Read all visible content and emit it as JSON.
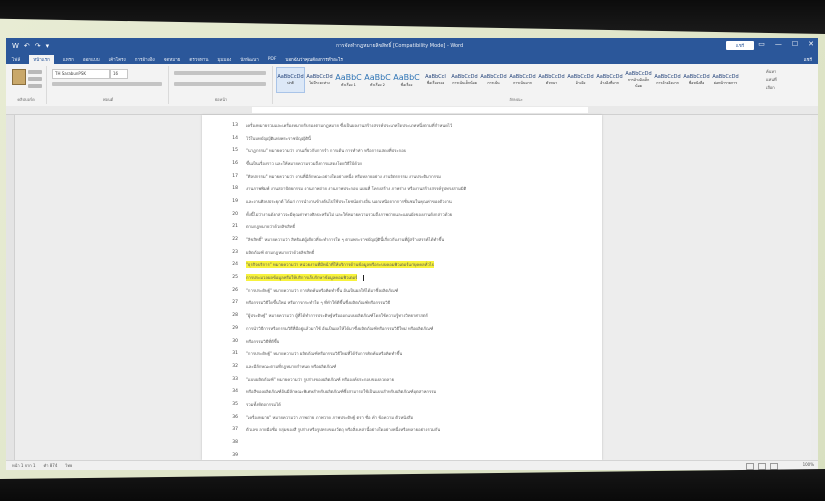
{
  "window": {
    "title": "การจัดทำกฎหมายลิขสิทธิ์ [Compatibility Mode] - Word",
    "signin": "แชร์",
    "controls": [
      "▭",
      "—",
      "☐",
      "✕"
    ]
  },
  "quick_access": [
    "W",
    "↶",
    "↷",
    "▾"
  ],
  "tabs": [
    "ไฟล์",
    "หน้าแรก",
    "แทรก",
    "ออกแบบ",
    "เค้าโครง",
    "การอ้างอิง",
    "จดหมาย",
    "ตรวจทาน",
    "มุมมอง",
    "นักพัฒนา",
    "PDF"
  ],
  "active_tab_index": 1,
  "tell_me": "บอกฉันว่าคุณต้องการทำอะไร",
  "share": "แชร์",
  "ribbon": {
    "clipboard_label": "คลิปบอร์ด",
    "font_name": "TH SarabunPSK",
    "font_size": "16",
    "font_label": "ฟอนต์",
    "paragraph_label": "ย่อหน้า",
    "styles_label": "ลักษณะ",
    "editing_label": "การแก้ไข",
    "editing_items": [
      "ค้นหา",
      "แทนที่",
      "เลือก"
    ],
    "styles": [
      {
        "sample": "AaBbCcDd",
        "name": "ปกติ",
        "big": false,
        "selected": true
      },
      {
        "sample": "AaBbCcDd",
        "name": "ไม่มีระยะห่าง",
        "big": false,
        "selected": false
      },
      {
        "sample": "AaBbC",
        "name": "หัวเรื่อง 1",
        "big": true,
        "selected": false
      },
      {
        "sample": "AaBbC",
        "name": "หัวเรื่อง 2",
        "big": true,
        "selected": false
      },
      {
        "sample": "AaBbC",
        "name": "ชื่อเรื่อง",
        "big": true,
        "selected": false
      },
      {
        "sample": "AaBbCcI",
        "name": "ชื่อเรื่องรอง",
        "big": false,
        "selected": false
      },
      {
        "sample": "AaBbCcDd",
        "name": "การเน้นเล็กน้อย",
        "big": false,
        "selected": false
      },
      {
        "sample": "AaBbCcDd",
        "name": "การเน้น",
        "big": false,
        "selected": false
      },
      {
        "sample": "AaBbCcDd",
        "name": "การเน้นมาก",
        "big": false,
        "selected": false
      },
      {
        "sample": "AaBbCcDd",
        "name": "ตัวหนา",
        "big": false,
        "selected": false
      },
      {
        "sample": "AaBbCcDd",
        "name": "อ้างอิง",
        "big": false,
        "selected": false
      },
      {
        "sample": "AaBbCcDd",
        "name": "อ้างอิงที่มาก",
        "big": false,
        "selected": false
      },
      {
        "sample": "AaBbCcDd",
        "name": "การอ้างอิงเล็กน้อย",
        "big": false,
        "selected": false
      },
      {
        "sample": "AaBbCcDd",
        "name": "การอ้างอิงมาก",
        "big": false,
        "selected": false
      },
      {
        "sample": "AaBbCcDd",
        "name": "ชื่อหนังสือ",
        "big": false,
        "selected": false
      },
      {
        "sample": "AaBbCcDd",
        "name": "ย่อหน้ารายการ",
        "big": false,
        "selected": false
      }
    ]
  },
  "document": {
    "lines": [
      {
        "num": "13",
        "text": "เครื่องหมายรวมและเครื่องหมายรับรองตามกฎหมาย ซึ่งเป็นผลงานสร้างสรรค์ประเภทใดประเภทหนึ่งตามที่กำหนดไว้",
        "highlight": false
      },
      {
        "num": "14",
        "text": "ไว้ในบทบัญญัติแห่งพระราชบัญญัตินี้",
        "highlight": false
      },
      {
        "num": "15",
        "text": "\"นาฏกรรม\" หมายความว่า งานเกี่ยวกับการรำ การเต้น การทำท่า หรือการแสดงที่ประกอบ",
        "highlight": false
      },
      {
        "num": "16",
        "text": "ขึ้นเป็นเรื่องราว และให้หมายความรวมถึงการแสดงโดยวิธีใบ้ด้วย",
        "highlight": false
      },
      {
        "num": "17",
        "text": "\"ศิลปกรรม\" หมายความว่า งานที่มีลักษณะอย่างใดอย่างหนึ่ง หรือหลายอย่าง งานจิตรกรรม งานประติมากรรม",
        "highlight": false
      },
      {
        "num": "18",
        "text": "งานภาพพิมพ์ งานสถาปัตยกรรม งานภาพถ่าย งานภาพประกอบ แผนที่ โครงสร้าง ภาพร่าง หรืองานสร้างสรรค์รูปทรงสามมิติ",
        "highlight": false
      },
      {
        "num": "19",
        "text": "และงานศิลปประยุกต์ ได้แก่ การนำงานข้างต้นไปใช้ประโยชน์อย่างอื่น นอกเหนือจากการชื่นชมในคุณค่าของตัวงาน",
        "highlight": false
      },
      {
        "num": "20",
        "text": "ทั้งนี้ไม่ว่างานดังกล่าวจะมีคุณค่าทางศิลปะหรือไม่ และให้หมายความรวมถึงภาพถ่ายและแผนผังของงานดังกล่าวด้วย",
        "highlight": false
      },
      {
        "num": "21",
        "text": "ตามกฎหมายว่าด้วยลิขสิทธิ์",
        "highlight": false
      },
      {
        "num": "22",
        "text": "\"ลิขสิทธิ์\" หมายความว่า สิทธิแต่ผู้เดียวที่จะทำการใด ๆ ตามพระราชบัญญัตินี้เกี่ยวกับงานที่ผู้สร้างสรรค์ได้ทำขึ้น",
        "highlight": false
      },
      {
        "num": "23",
        "text": "ผลิตภัณฑ์ ตามกฎหมายว่าด้วยลิขสิทธิ์",
        "highlight": false
      },
      {
        "num": "24",
        "text": "\"ธุรกิจบริการ\" หมายความว่า หน่วยงานที่มีหน้าที่ให้บริการด้านข้อมูลหรือระบบคอมพิวเตอร์แก่บุคคลทั่วไป",
        "highlight": true
      },
      {
        "num": "25",
        "text": "การประมวลผลข้อมูลหรือให้บริการเก็บรักษาข้อมูลคอมพิวเตอร์",
        "highlight": true,
        "cursor": true
      },
      {
        "num": "26",
        "text": "\"การประดิษฐ์\" หมายความว่า การคิดค้นหรือคิดทำขึ้น อันเป็นผลให้ได้มาซึ่งผลิตภัณฑ์",
        "highlight": false
      },
      {
        "num": "27",
        "text": "หรือกรรมวิธีใดขึ้นใหม่ หรือการกระทำใด ๆ ที่ทำให้ดีขึ้นซึ่งผลิตภัณฑ์หรือกรรมวิธี",
        "highlight": false
      },
      {
        "num": "28",
        "text": "\"ผู้ประดิษฐ์\" หมายความว่า ผู้ที่ได้ทำการประดิษฐ์หรือออกแบบผลิตภัณฑ์โดยใช้ความรู้ทางวิทยาศาสตร์",
        "highlight": false
      },
      {
        "num": "29",
        "text": "การนำวิธีการหรือกรรมวิธีที่มีอยู่แล้วมาใช้ อันเป็นผลให้ได้มาซึ่งผลิตภัณฑ์หรือกรรมวิธีใหม่ หรือผลิตภัณฑ์",
        "highlight": false
      },
      {
        "num": "30",
        "text": "หรือกรรมวิธีที่ดีขึ้น",
        "highlight": false
      },
      {
        "num": "31",
        "text": "\"การประดิษฐ์\" หมายความว่า ผลิตภัณฑ์หรือกรรมวิธีใหม่ที่ได้รับการคิดค้นหรือคิดทำขึ้น",
        "highlight": false
      },
      {
        "num": "32",
        "text": "และมีลักษณะตามที่กฎหมายกำหนด หรือผลิตภัณฑ์",
        "highlight": false
      },
      {
        "num": "33",
        "text": "\"แบบผลิตภัณฑ์\" หมายความว่า รูปร่างของผลิตภัณฑ์ หรือองค์ประกอบของลวดลาย",
        "highlight": false
      },
      {
        "num": "34",
        "text": "หรือสีของผลิตภัณฑ์อันมีลักษณะพิเศษสำหรับผลิตภัณฑ์ซึ่งสามารถใช้เป็นแบบสำหรับผลิตภัณฑ์อุตสาหกรรม",
        "highlight": false
      },
      {
        "num": "35",
        "text": "รวมทั้งหัตถกรรมได้",
        "highlight": false
      },
      {
        "num": "36",
        "text": "\"เครื่องหมาย\" หมายความว่า ภาพถ่าย ภาพวาด ภาพประดิษฐ์ ตรา ชื่อ คำ ข้อความ ตัวหนังสือ",
        "highlight": false
      },
      {
        "num": "37",
        "text": "ตัวเลข ลายมือชื่อ กลุ่มของสี รูปร่างหรือรูปทรงของวัตถุ หรือสิ่งเหล่านี้อย่างใดอย่างหนึ่งหรือหลายอย่างรวมกัน",
        "highlight": false
      },
      {
        "num": "38",
        "text": "",
        "highlight": false
      },
      {
        "num": "39",
        "text": "",
        "highlight": false
      }
    ]
  },
  "status": {
    "page": "หน้า 1 จาก 1",
    "words": "คำ 874",
    "language": "ไทย",
    "zoom": "100%"
  }
}
